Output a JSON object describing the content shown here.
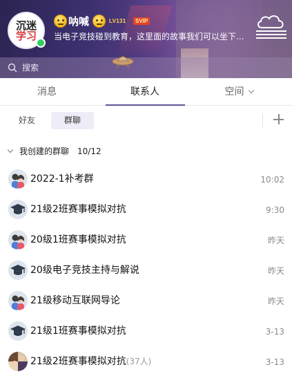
{
  "profile": {
    "avatar_line1": "沉迷",
    "avatar_line2": "学习",
    "nickname": "呐喊",
    "level_badge": "LV131",
    "vip_badge": "SVIP",
    "signature": "当电子竞技碰到教育，这里面的故事我们可以坐下..."
  },
  "search": {
    "placeholder": "搜索"
  },
  "tabs": [
    {
      "label": "消息"
    },
    {
      "label": "联系人"
    },
    {
      "label": "空间"
    }
  ],
  "subtabs": [
    {
      "label": "好友"
    },
    {
      "label": "群聊"
    }
  ],
  "section": {
    "title": "我创建的群聊",
    "count": "10/12"
  },
  "groups": [
    {
      "name": "2022-1补考群",
      "time": "10:02",
      "icon": "people-avatar"
    },
    {
      "name": "21级2班赛事模拟对抗",
      "time": "9:30",
      "icon": "graduation-cap-avatar"
    },
    {
      "name": "20级1班赛事模拟对抗",
      "time": "昨天",
      "icon": "people-avatar"
    },
    {
      "name": "20级电子竞技主持与解说",
      "time": "昨天",
      "icon": "graduation-cap-avatar"
    },
    {
      "name": "21级移动互联网导论",
      "time": "昨天",
      "icon": "people-avatar"
    },
    {
      "name": "21级1班赛事模拟对抗",
      "time": "3-13",
      "icon": "graduation-cap-avatar"
    },
    {
      "name": "21级2班赛事模拟对抗",
      "member_count": "(37人)",
      "time": "3-13",
      "icon": "photo-avatar"
    }
  ],
  "colors": {
    "header_start": "#2c2452",
    "header_end": "#7d5a94",
    "tab_underline": "#5b5592",
    "subtab_active_bg": "#eeecf6",
    "online": "#2fd160",
    "vip_badge": "#e2432a"
  }
}
